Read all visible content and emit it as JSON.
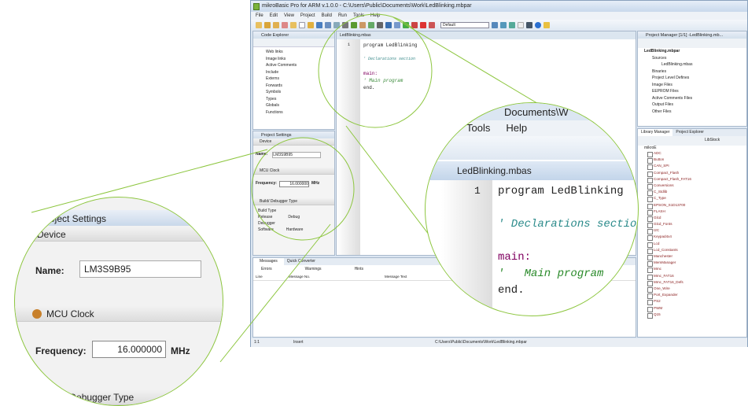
{
  "window": {
    "title": "mikroBasic Pro for ARM v.1.0.0 - C:\\Users\\Public\\Documents\\Work\\LedBlinking.mbpar"
  },
  "menu": [
    "File",
    "Edit",
    "View",
    "Project",
    "Build",
    "Run",
    "Tools",
    "Help"
  ],
  "toolbar": {
    "config_select": "Default"
  },
  "code_explorer": {
    "title": "Code Explorer",
    "items": [
      "Web links",
      "Image links",
      "Active Comments",
      "Include",
      "Externs",
      "Forwards",
      "Symbols",
      "Types",
      "Globals",
      "Functions"
    ]
  },
  "project_settings": {
    "title": "Project Settings",
    "device_section": "Device",
    "name_label": "Name:",
    "name_value": "LM3S9B95",
    "clock_section": "MCU Clock",
    "freq_label": "Frequency:",
    "freq_value": "16.000000",
    "freq_unit": "MHz",
    "build_section": "Build/ Debugger Type",
    "build_type_label": "Build Type",
    "release": "Release",
    "debug": "Debug",
    "debugger_label": "Debugger",
    "software": "Software",
    "hardware": "Hardware"
  },
  "editor": {
    "tab": "LedBlinking.mbas",
    "line1_num": "1",
    "code": [
      "program LedBlinking",
      "",
      "' Declarations section",
      "",
      "main:",
      "'   Main program",
      "end."
    ]
  },
  "project_manager": {
    "title": "Project Manager [1/1] -LedBlinking.mb...",
    "root": "LedBlinking.mbpar",
    "sources": "Sources",
    "file": "LedBlinking.mbas",
    "folders": [
      "Binaries",
      "Project Level Defines",
      "Image Files",
      "EEPROM Files",
      "Active Comments Files",
      "Output Files",
      "Other Files"
    ]
  },
  "library": {
    "tabs": [
      "Library Manager",
      "Project Explorer"
    ],
    "libstock": "LibStock",
    "root": "mikroE",
    "items": [
      "ADC",
      "Button",
      "CAN_SPI",
      "Compact_Flash",
      "Compact_Flash_FAT16",
      "Conversions",
      "C_Stdlib",
      "C_Type",
      "EPSON_S1D13700",
      "FLASH",
      "Glcd",
      "Glcd_Fonts",
      "I2C",
      "Keypad4x4",
      "Lcd",
      "Lcd_Constants",
      "Manchester",
      "MemManager",
      "Mmc",
      "Mmc_FAT16",
      "Mmc_FAT16_Defs",
      "One_Wire",
      "Port_Expander",
      "PS2",
      "PWM",
      "Q15"
    ]
  },
  "messages": {
    "tabs": [
      "Messages",
      "Quick Converter"
    ],
    "filters": [
      "Errors",
      "Warnings",
      "Hints"
    ],
    "columns": [
      "Line",
      "Message No.",
      "Message Text"
    ]
  },
  "status": {
    "pos": "1:1",
    "mode": "Insert",
    "path": "C:\\Users\\Public\\Documents\\Work\\LedBlinking.mbpar"
  },
  "zoom_right": {
    "fragment": "Documents\\W",
    "menu": [
      "Tools",
      "Help"
    ]
  }
}
